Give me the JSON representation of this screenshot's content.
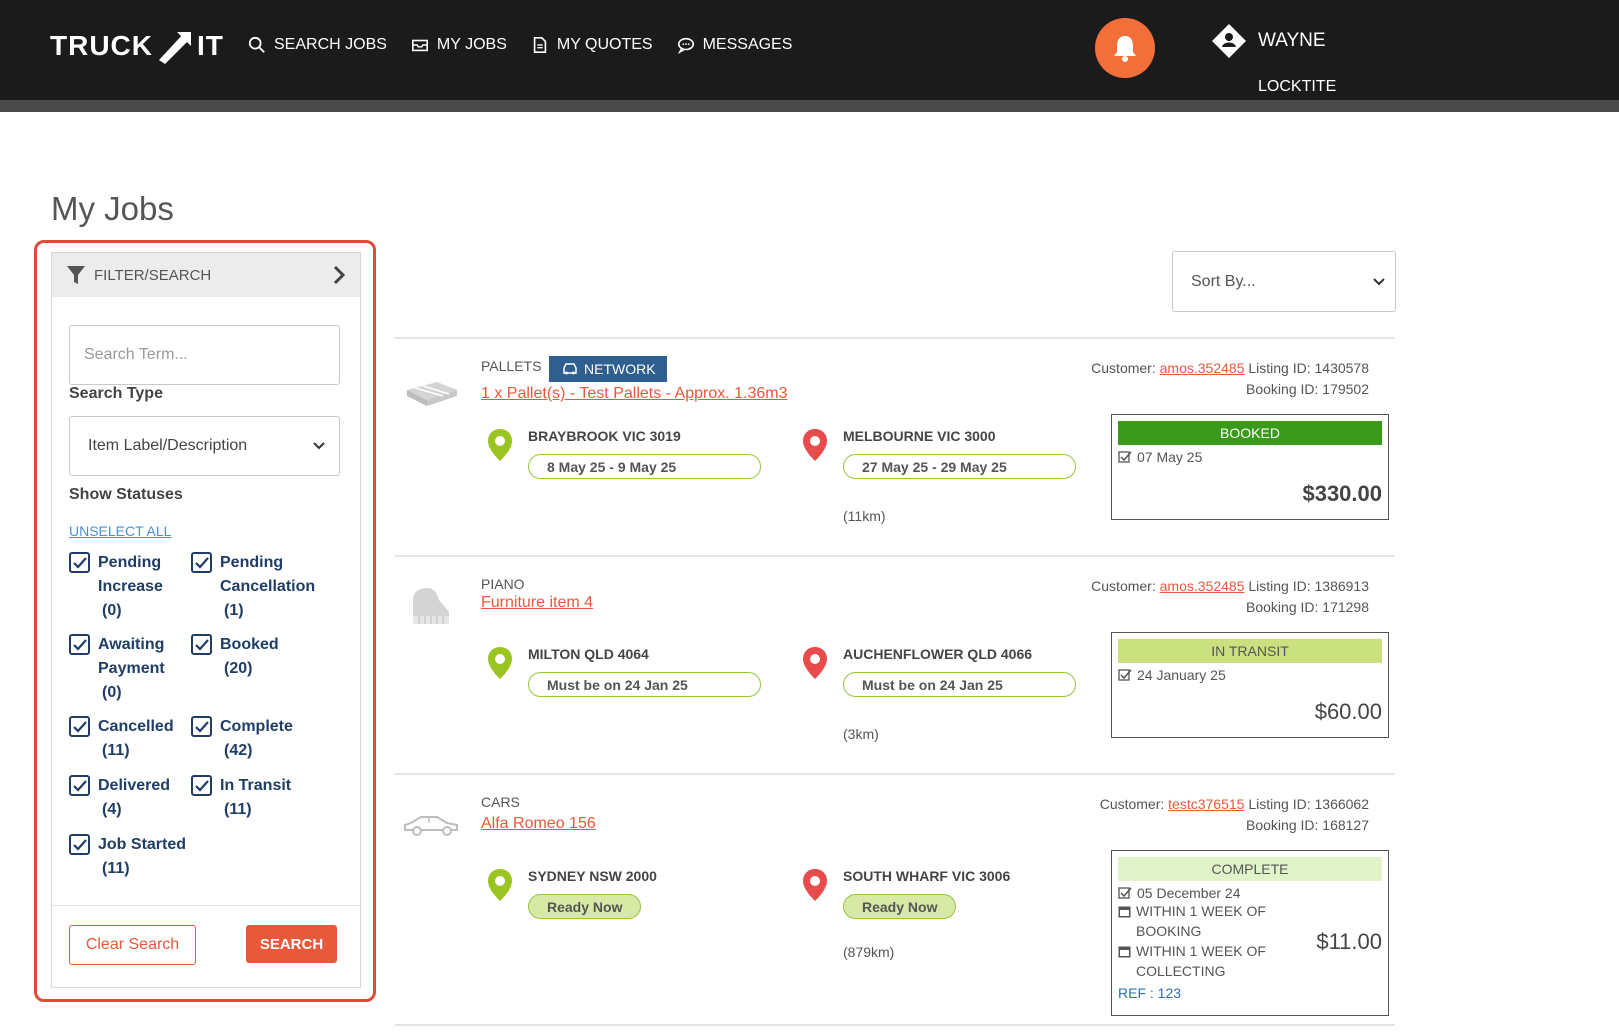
{
  "header": {
    "logo_left": "TRUCK",
    "logo_right": "IT",
    "nav": [
      {
        "label": "SEARCH JOBS",
        "icon": "search-icon"
      },
      {
        "label": "MY JOBS",
        "icon": "inbox-icon"
      },
      {
        "label": "MY QUOTES",
        "icon": "document-icon"
      },
      {
        "label": "MESSAGES",
        "icon": "chat-icon"
      }
    ],
    "user_name": "WAYNE",
    "company": "LOCKTITE"
  },
  "page": {
    "title": "My Jobs"
  },
  "sidebar": {
    "header_label": "FILTER/SEARCH",
    "search_placeholder": "Search Term...",
    "search_type_label": "Search Type",
    "search_type_value": "Item Label/Description",
    "show_statuses_label": "Show Statuses",
    "unselect_all": "UNSELECT ALL",
    "statuses": [
      {
        "name": "Pending Increase",
        "line1": "Pending",
        "line2": "Increase",
        "count": "(0)",
        "checked": true
      },
      {
        "name": "Pending Cancellation",
        "line1": "Pending",
        "line2": "Cancellation",
        "count": "(1)",
        "checked": true
      },
      {
        "name": "Awaiting Payment",
        "line1": "Awaiting",
        "line2": "Payment",
        "count": "(0)",
        "checked": true
      },
      {
        "name": "Booked",
        "line1": "Booked",
        "line2": "",
        "count": "(20)",
        "checked": true
      },
      {
        "name": "Cancelled",
        "line1": "Cancelled",
        "line2": "",
        "count": "(11)",
        "checked": true
      },
      {
        "name": "Complete",
        "line1": "Complete",
        "line2": "",
        "count": "(42)",
        "checked": true
      },
      {
        "name": "Delivered",
        "line1": "Delivered",
        "line2": "",
        "count": "(4)",
        "checked": true
      },
      {
        "name": "In Transit",
        "line1": "In Transit",
        "line2": "",
        "count": "(11)",
        "checked": true
      },
      {
        "name": "Job Started",
        "line1": "Job Started",
        "line2": "",
        "count": "(11)",
        "checked": true
      }
    ],
    "clear_label": "Clear Search",
    "search_label": "SEARCH"
  },
  "sort": {
    "value": "Sort By..."
  },
  "jobs": [
    {
      "category": "PALLETS",
      "network_badge": "NETWORK",
      "title": "1 x Pallet(s) - Test Pallets - Approx. 1.36m3",
      "customer_label": "Customer:",
      "customer": "amos.352485",
      "listing": "Listing ID: 1430578",
      "booking": "Booking ID: 179502",
      "pickup": {
        "place": "BRAYBROOK VIC 3019",
        "date": "8 May 25 - 9 May 25"
      },
      "dropoff": {
        "place": "MELBOURNE VIC 3000",
        "date": "27 May 25 - 29 May 25"
      },
      "distance": "(11km)",
      "status": "BOOKED",
      "status_color": "#3a9a1c",
      "status_text_color": "#ffffff",
      "status_date": "07 May 25",
      "price": "$330.00"
    },
    {
      "category": "PIANO",
      "title": "Furniture item 4",
      "customer_label": "Customer:",
      "customer": "amos.352485",
      "listing": "Listing ID: 1386913",
      "booking": "Booking ID: 171298",
      "pickup": {
        "place": "MILTON QLD 4064",
        "date": "Must be on 24 Jan 25"
      },
      "dropoff": {
        "place": "AUCHENFLOWER QLD 4066",
        "date": "Must be on 24 Jan 25"
      },
      "distance": "(3km)",
      "status": "IN TRANSIT",
      "status_color": "#cbe07e",
      "status_text_color": "#555555",
      "status_date": "24 January 25",
      "price": "$60.00"
    },
    {
      "category": "CARS",
      "title": "Alfa Romeo 156",
      "customer_label": "Customer:",
      "customer": "testc376515",
      "listing": "Listing ID: 1366062",
      "booking": "Booking ID: 168127",
      "pickup": {
        "place": "SYDNEY NSW 2000",
        "date": "Ready Now"
      },
      "dropoff": {
        "place": "SOUTH WHARF VIC 3006",
        "date": "Ready Now"
      },
      "distance": "(879km)",
      "status": "COMPLETE",
      "status_color": "#e1f3c8",
      "status_text_color": "#555555",
      "status_date": "05 December 24",
      "booking_window": "WITHIN 1 WEEK OF BOOKING",
      "collecting_window": "WITHIN 1 WEEK OF COLLECTING",
      "ref": "REF : 123",
      "price": "$11.00"
    }
  ]
}
